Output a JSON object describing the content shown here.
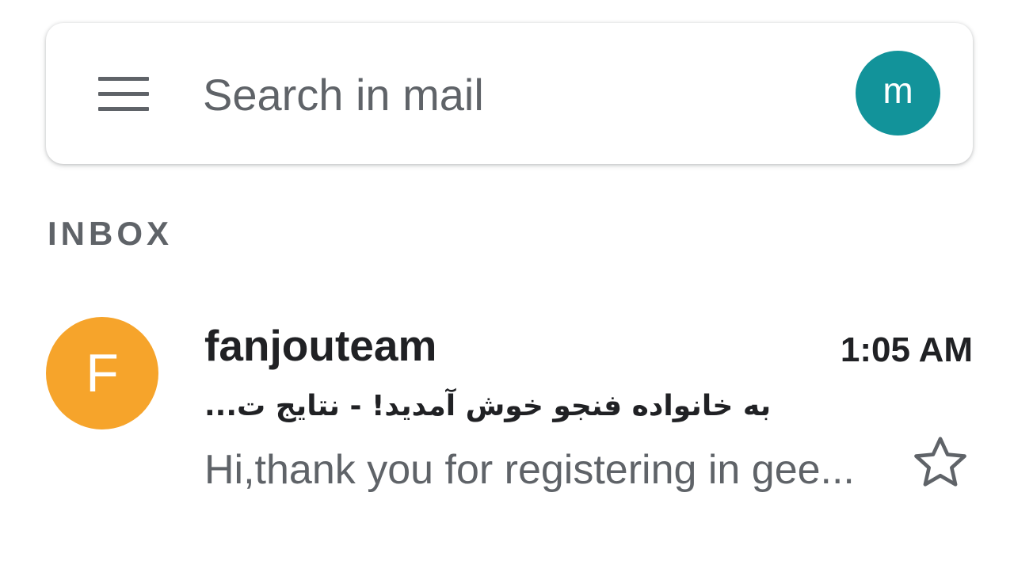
{
  "search": {
    "placeholder": "Search in mail",
    "menu_icon": "hamburger-menu-icon",
    "account_initial": "m",
    "account_color": "#12939a"
  },
  "section": {
    "label": "INBOX"
  },
  "emails": [
    {
      "avatar_initial": "F",
      "avatar_color": "#f6a42b",
      "sender": "fanjouteam",
      "time": "1:05 AM",
      "subject": "به خانواده فنجو خوش آمدید! - نتایج ت...",
      "snippet": "Hi,thank you for registering in gee...",
      "star_icon": "star-outline-icon",
      "starred": false
    }
  ]
}
